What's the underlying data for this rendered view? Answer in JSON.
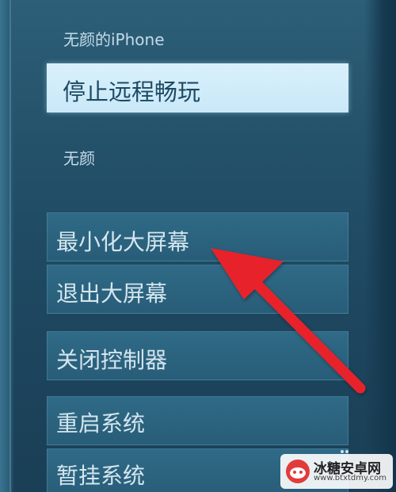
{
  "menu": {
    "device_name": "无颜的iPhone",
    "stop_remote_play": "停止远程畅玩",
    "user_name": "无颜",
    "minimize_big_picture": "最小化大屏幕",
    "exit_big_picture": "退出大屏幕",
    "close_controller": "关闭控制器",
    "restart_system": "重启系统",
    "suspend_system": "暂挂系统"
  },
  "annotation": {
    "arrow_color": "#e8232a",
    "arrow_icon": "red-arrow-icon"
  },
  "watermark": {
    "title": "冰糖安卓网",
    "url": "www.btxtdmy.com"
  },
  "colors": {
    "background": "#24516a",
    "highlight": "#d9f0fb",
    "menu_item": "#2f6a86",
    "text": "#d4e6ef"
  }
}
